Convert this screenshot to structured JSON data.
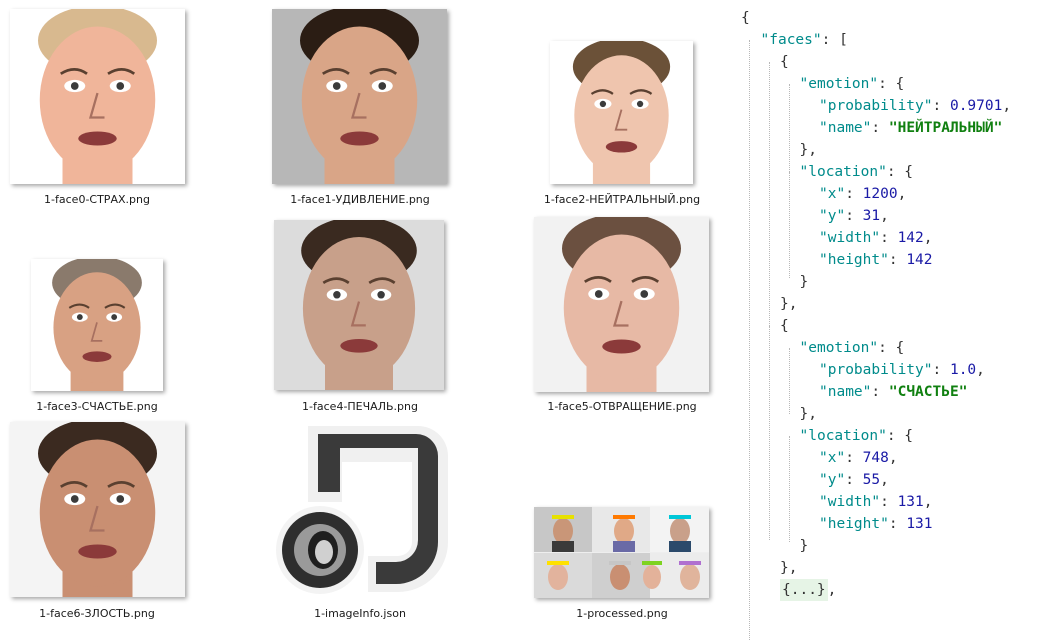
{
  "explorer": {
    "files": [
      {
        "name": "1-face0-СТРАХ.png",
        "kind": "face",
        "skin": "#f0b59a",
        "bg": "#ffffff",
        "hair": "#d8b98f"
      },
      {
        "name": "1-face1-УДИВЛЕНИЕ.png",
        "kind": "face",
        "skin": "#d9a587",
        "bg": "#b7b7b7",
        "hair": "#2b1d14"
      },
      {
        "name": "1-face2-НЕЙТРАЛЬНЫЙ.png",
        "kind": "face",
        "skin": "#efc5ae",
        "bg": "#ffffff",
        "hair": "#6b5138"
      },
      {
        "name": "1-face3-СЧАСТЬЕ.png",
        "kind": "face",
        "skin": "#d8a183",
        "bg": "#ffffff",
        "hair": "#8a7a6c"
      },
      {
        "name": "1-face4-ПЕЧАЛЬ.png",
        "kind": "face",
        "skin": "#c8a08a",
        "bg": "#dcdcdc",
        "hair": "#3a2a20"
      },
      {
        "name": "1-face5-ОТВРАЩЕНИЕ.png",
        "kind": "face",
        "skin": "#e7b9a5",
        "bg": "#f2f2f2",
        "hair": "#6b5040"
      },
      {
        "name": "1-face6-ЗЛОСТЬ.png",
        "kind": "face",
        "skin": "#c98f72",
        "bg": "#f4f4f4",
        "hair": "#3b2a20"
      },
      {
        "name": "1-imageInfo.json",
        "kind": "json-icon"
      },
      {
        "name": "1-processed.png",
        "kind": "collage"
      }
    ]
  },
  "json_view": {
    "lines": [
      [
        [
          "p",
          "{"
        ]
      ],
      [
        [
          "k",
          "\"faces\""
        ],
        [
          "p",
          ": ["
        ]
      ],
      [
        [
          "p",
          "{"
        ]
      ],
      [
        [
          "k",
          "\"emotion\""
        ],
        [
          "p",
          ": {"
        ]
      ],
      [
        [
          "k",
          "\"probability\""
        ],
        [
          "p",
          ": "
        ],
        [
          "n",
          "0.9701"
        ],
        [
          "p",
          ","
        ]
      ],
      [
        [
          "k",
          "\"name\""
        ],
        [
          "p",
          ": "
        ],
        [
          "s",
          "\"НЕЙТРАЛЬНЫЙ\""
        ]
      ],
      [
        [
          "p",
          "},"
        ]
      ],
      [
        [
          "k",
          "\"location\""
        ],
        [
          "p",
          ": {"
        ]
      ],
      [
        [
          "k",
          "\"x\""
        ],
        [
          "p",
          ": "
        ],
        [
          "n",
          "1200"
        ],
        [
          "p",
          ","
        ]
      ],
      [
        [
          "k",
          "\"y\""
        ],
        [
          "p",
          ": "
        ],
        [
          "n",
          "31"
        ],
        [
          "p",
          ","
        ]
      ],
      [
        [
          "k",
          "\"width\""
        ],
        [
          "p",
          ": "
        ],
        [
          "n",
          "142"
        ],
        [
          "p",
          ","
        ]
      ],
      [
        [
          "k",
          "\"height\""
        ],
        [
          "p",
          ": "
        ],
        [
          "n",
          "142"
        ]
      ],
      [
        [
          "p",
          "}"
        ]
      ],
      [
        [
          "p",
          "},"
        ]
      ],
      [
        [
          "p",
          "{"
        ]
      ],
      [
        [
          "k",
          "\"emotion\""
        ],
        [
          "p",
          ": {"
        ]
      ],
      [
        [
          "k",
          "\"probability\""
        ],
        [
          "p",
          ": "
        ],
        [
          "n",
          "1.0"
        ],
        [
          "p",
          ","
        ]
      ],
      [
        [
          "k",
          "\"name\""
        ],
        [
          "p",
          ": "
        ],
        [
          "s",
          "\"СЧАСТЬЕ\""
        ]
      ],
      [
        [
          "p",
          "},"
        ]
      ],
      [
        [
          "k",
          "\"location\""
        ],
        [
          "p",
          ": {"
        ]
      ],
      [
        [
          "k",
          "\"x\""
        ],
        [
          "p",
          ": "
        ],
        [
          "n",
          "748"
        ],
        [
          "p",
          ","
        ]
      ],
      [
        [
          "k",
          "\"y\""
        ],
        [
          "p",
          ": "
        ],
        [
          "n",
          "55"
        ],
        [
          "p",
          ","
        ]
      ],
      [
        [
          "k",
          "\"width\""
        ],
        [
          "p",
          ": "
        ],
        [
          "n",
          "131"
        ],
        [
          "p",
          ","
        ]
      ],
      [
        [
          "k",
          "\"height\""
        ],
        [
          "p",
          ": "
        ],
        [
          "n",
          "131"
        ]
      ],
      [
        [
          "p",
          "}"
        ]
      ],
      [
        [
          "p",
          "},"
        ]
      ],
      [
        [
          "c",
          "{...}"
        ],
        [
          "p",
          ","
        ]
      ]
    ]
  }
}
